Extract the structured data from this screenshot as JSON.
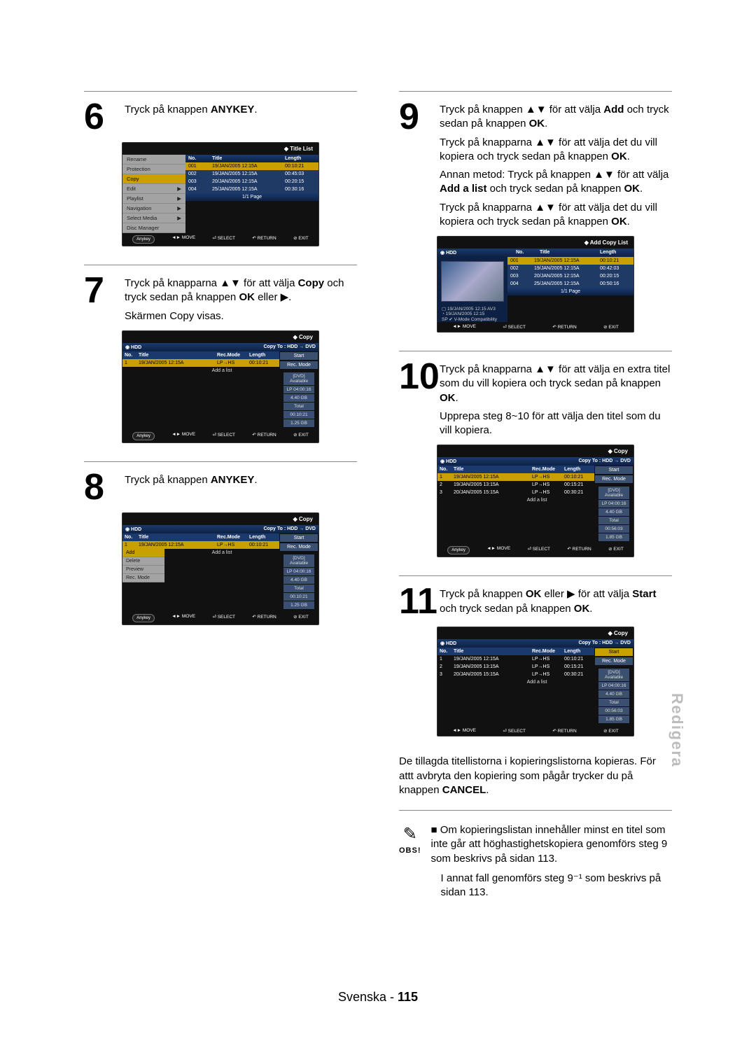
{
  "side_tab": "Redigera",
  "page_footer": {
    "lang": "Svenska",
    "sep": " - ",
    "num": "115"
  },
  "note": {
    "label": "OBS!",
    "lines": [
      "Om kopieringslistan innehåller minst en titel som inte går att höghastighetskopiera genomförs steg 9 som beskrivs på sidan 113.",
      "I annat fall genomförs steg 9⁻¹ som beskrivs på sidan 113."
    ]
  },
  "steps": {
    "s6": {
      "num": "6",
      "text": "Tryck på knappen ",
      "b": "ANYKEY",
      "tail": "."
    },
    "s7": {
      "num": "7",
      "l1": "Tryck på knapparna ▲▼ för att välja",
      "l1b": "Copy",
      "l1t": " och tryck sedan på knappen ",
      "l1b2": "OK",
      "l1t2": " eller ▶.",
      "l2": "Skärmen Copy visas."
    },
    "s8": {
      "num": "8",
      "text": "Tryck på knappen ",
      "b": "ANYKEY",
      "tail": "."
    },
    "s9": {
      "num": "9",
      "p1": "Tryck på knappen ▲▼ för att välja ",
      "p1b": "Add",
      "p1t": " och tryck sedan på knappen ",
      "p1b2": "OK",
      "p1t2": ".",
      "p2": "Tryck på knapparna ▲▼ för att välja det du vill kopiera och tryck sedan på knappen ",
      "p2b": "OK",
      "p2t": ".",
      "p3": "Annan metod: Tryck på knappen ▲▼ för att välja ",
      "p3b": "Add a list",
      "p3t": " och tryck sedan på knappen ",
      "p3b2": "OK",
      "p3t2": ".",
      "p4": "Tryck på knapparna ▲▼ för att välja det du vill kopiera och tryck sedan på knappen ",
      "p4b": "OK",
      "p4t": "."
    },
    "s10": {
      "num": "10",
      "p1": "Tryck på knapparna ▲▼ för att välja en extra titel som du vill kopiera och tryck sedan på knappen ",
      "p1b": "OK",
      "p1t": ".",
      "p2": "Upprepa steg 8~10 för att välja den titel som du vill kopiera."
    },
    "s11": {
      "num": "11",
      "p1": "Tryck på knappen ",
      "p1b": "OK",
      "p1t": " eller ▶ för att välja ",
      "p1b2": "Start",
      "p1t2": " och tryck sedan på knappen ",
      "p1b3": "OK",
      "p1t3": ".",
      "after": "De tillagda titellistorna i kopieringslistorna kopieras. För attt avbryta den kopiering som pågår trycker du på knappen ",
      "afterb": "CANCEL",
      "aftert": "."
    }
  },
  "osd_title_list": {
    "title": "Title List",
    "menu": [
      "Rename",
      "Protection",
      "Copy",
      "Edit",
      "Playlist",
      "Navigation",
      "Select Media",
      "Disc Manager"
    ],
    "menu_sel": "Copy",
    "menu_arrow": [
      "Edit",
      "Playlist",
      "Navigation",
      "Select Media"
    ],
    "cols": [
      "No.",
      "Title",
      "Length"
    ],
    "rows": [
      {
        "no": "001",
        "t": "19/JAN/2005 12:15A",
        "len": "00:10:21",
        "sel": true
      },
      {
        "no": "002",
        "t": "19/JAN/2005 12:15A",
        "len": "00:45:03"
      },
      {
        "no": "003",
        "t": "20/JAN/2005 12:15A",
        "len": "00:20:15"
      },
      {
        "no": "004",
        "t": "25/JAN/2005 12:15A",
        "len": "00:30:16"
      }
    ],
    "page": "1/1 Page",
    "help": [
      "MOVE",
      "SELECT",
      "RETURN",
      "EXIT"
    ],
    "anykey": "Anykey"
  },
  "osd_copy_common": {
    "title": "Copy",
    "hdd": "HDD",
    "copy_to": "Copy To : HDD → DVD",
    "tbl_head": [
      "No.",
      "Title",
      "Rec.Mode",
      "Length"
    ],
    "side": [
      "Start",
      "Rec. Mode"
    ],
    "under": [
      "[DVD] Available",
      "LP   04:00:16",
      "4.40 GB",
      "Total",
      "00:10:21",
      "1.25 GB"
    ],
    "add_a_list": "Add a list",
    "page": "",
    "help_move": "MOVE",
    "help_sel": "SELECT",
    "help_ret": "RETURN",
    "help_exit": "EXIT",
    "anykey": "Anykey"
  },
  "osd_copy7": {
    "rows": [
      {
        "no": "1",
        "t": "19/JAN/2005 12:15A",
        "rm": "LP→HS",
        "len": "00:10:21",
        "sel": true
      }
    ]
  },
  "osd_copy8": {
    "rows": [
      {
        "no": "1",
        "t": "19/JAN/2005 12:15A",
        "rm": "LP→HS",
        "len": "00:10:21",
        "sel": true
      }
    ],
    "submenu": [
      "Add",
      "Delete",
      "Preview",
      "Rec. Mode"
    ],
    "submenu_sel": "Add"
  },
  "osd_add_copy_list": {
    "title": "Add Copy List",
    "hdd": "HDD",
    "cols": [
      "No.",
      "Title",
      "Length"
    ],
    "rows": [
      {
        "no": "001",
        "t": "19/JAN/2005 12:15A",
        "len": "00:10:21",
        "sel": true
      },
      {
        "no": "002",
        "t": "19/JAN/2005 12:15A",
        "len": "00:42:03"
      },
      {
        "no": "003",
        "t": "20/JAN/2005 12:15A",
        "len": "00:20:15"
      },
      {
        "no": "004",
        "t": "25/JAN/2005 12:15A",
        "len": "00:50:16"
      }
    ],
    "meta1": "19/JAN/2005 12:15 AV3",
    "meta2": "19/JAN/2005 12:15",
    "meta3": "SP  ✔ V-Mode Compatibility",
    "page": "1/1 Page",
    "help": [
      "MOVE",
      "SELECT",
      "RETURN",
      "EXIT"
    ]
  },
  "osd_copy10": {
    "rows": [
      {
        "no": "1",
        "t": "19/JAN/2005 12:15A",
        "rm": "LP→HS",
        "len": "00:10:21",
        "sel": true
      },
      {
        "no": "2",
        "t": "19/JAN/2005 13:15A",
        "rm": "LP→HS",
        "len": "00:15:21"
      },
      {
        "no": "3",
        "t": "20/JAN/2005 15:15A",
        "rm": "LP→HS",
        "len": "00:30:21"
      }
    ],
    "under": [
      "[DVD] Available",
      "LP   04:00:16",
      "4.40 GB",
      "Total",
      "00:56:03",
      "1.85 GB"
    ]
  },
  "osd_copy11": {
    "rows": [
      {
        "no": "1",
        "t": "19/JAN/2005 12:15A",
        "rm": "LP→HS",
        "len": "00:10:21"
      },
      {
        "no": "2",
        "t": "19/JAN/2005 13:15A",
        "rm": "LP→HS",
        "len": "00:15:21"
      },
      {
        "no": "3",
        "t": "20/JAN/2005 15:15A",
        "rm": "LP→HS",
        "len": "00:30:21"
      }
    ],
    "side_sel": "Start",
    "under": [
      "[DVD] Available",
      "LP   04:00:16",
      "4.40 GB",
      "Total",
      "00:56:03",
      "1.85 GB"
    ]
  }
}
